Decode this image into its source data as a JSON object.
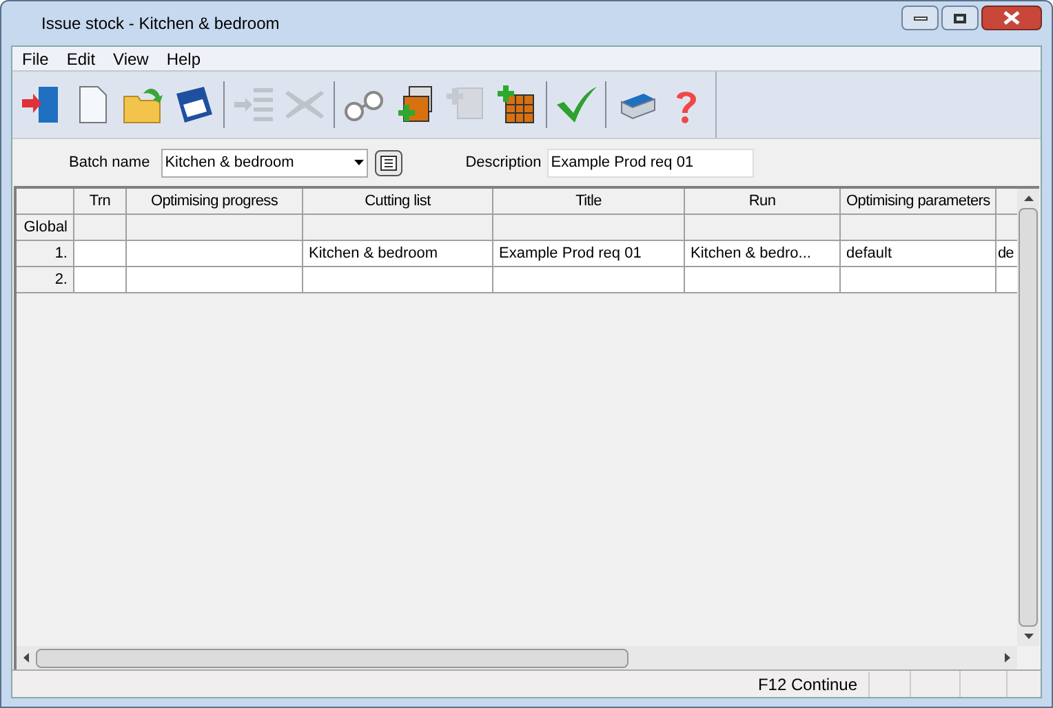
{
  "window": {
    "title": "Issue stock - Kitchen & bedroom"
  },
  "menu": [
    "File",
    "Edit",
    "View",
    "Help"
  ],
  "toolbar": [
    {
      "kind": "exit",
      "disabled": false
    },
    {
      "kind": "new",
      "disabled": false
    },
    {
      "kind": "open",
      "disabled": false
    },
    {
      "kind": "save",
      "disabled": false
    },
    {
      "kind": "separator"
    },
    {
      "kind": "indent",
      "disabled": true
    },
    {
      "kind": "delete",
      "disabled": true
    },
    {
      "kind": "separator"
    },
    {
      "kind": "glasses",
      "disabled": false
    },
    {
      "kind": "add-batch",
      "disabled": false
    },
    {
      "kind": "add-document",
      "disabled": true
    },
    {
      "kind": "add-grid",
      "disabled": false
    },
    {
      "kind": "separator"
    },
    {
      "kind": "check",
      "disabled": false
    },
    {
      "kind": "separator"
    },
    {
      "kind": "print",
      "disabled": false
    },
    {
      "kind": "help",
      "disabled": false
    }
  ],
  "batch_name": {
    "label": "Batch name",
    "value": "Kitchen & bedroom"
  },
  "description": {
    "label": "Description",
    "value": "Example Prod req 01"
  },
  "table": {
    "columns": [
      "Trn",
      "Optimising progress",
      "Cutting list",
      "Title",
      "Run",
      "Optimising parameters"
    ],
    "rows": [
      {
        "label": "Global",
        "cells": [
          null,
          null,
          null,
          null,
          null,
          null,
          null
        ]
      },
      {
        "label": "1.",
        "cells": [
          null,
          null,
          "Kitchen & bedroom",
          "Example Prod req 01",
          "Kitchen & bedro...",
          "default",
          "de"
        ]
      },
      {
        "label": "2.",
        "cells": [
          null,
          null,
          null,
          null,
          null,
          null,
          null
        ]
      }
    ]
  },
  "status_bar": {
    "text": "F12 Continue"
  }
}
